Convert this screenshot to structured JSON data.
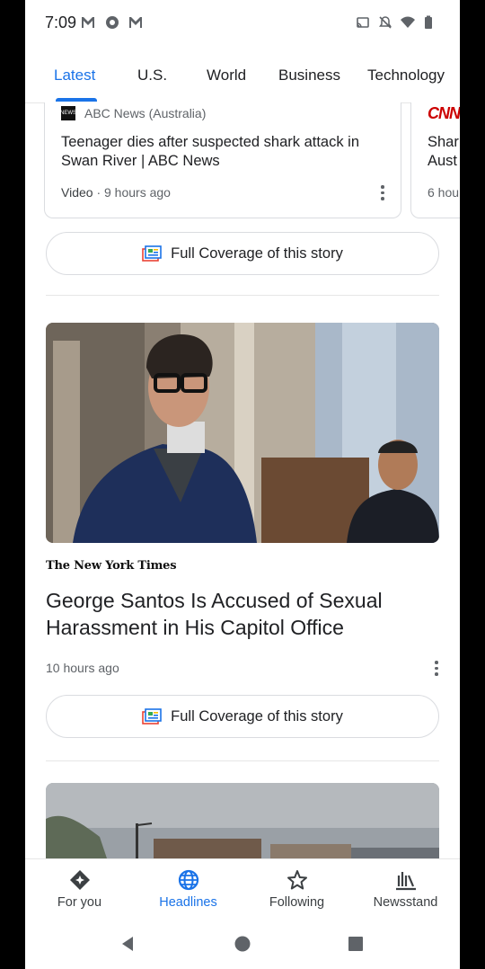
{
  "status_bar": {
    "time": "7:09",
    "icons": [
      "gmail-icon",
      "settings-app-icon",
      "gmail-icon",
      "cast-icon",
      "bell-off-icon",
      "wifi-icon",
      "battery-icon"
    ]
  },
  "tabs": [
    {
      "label": "Latest",
      "active": true
    },
    {
      "label": "U.S.",
      "active": false
    },
    {
      "label": "World",
      "active": false
    },
    {
      "label": "Business",
      "active": false
    },
    {
      "label": "Technology",
      "active": false
    }
  ],
  "carousel": {
    "card1": {
      "source": "ABC News (Australia)",
      "logo_text": "NEWS",
      "title": "Teenager dies after suspected shark attack in Swan River | ABC News",
      "meta_type": "Video",
      "meta_time": "· 9 hours ago"
    },
    "card2": {
      "source_logo": "CNN",
      "title_line1": "Shar",
      "title_line2": "Aust",
      "meta": "6 hou"
    }
  },
  "full_coverage_1": {
    "label": "Full Coverage of this story"
  },
  "story": {
    "publisher": "The New York Times",
    "headline": "George Santos Is Accused of Sexual Harassment in His Capitol Office",
    "time": "10 hours ago"
  },
  "full_coverage_2": {
    "label": "Full Coverage of this story"
  },
  "bottom_nav": [
    {
      "label": "For you",
      "icon": "for-you-icon",
      "active": false
    },
    {
      "label": "Headlines",
      "icon": "globe-icon",
      "active": true
    },
    {
      "label": "Following",
      "icon": "star-icon",
      "active": false
    },
    {
      "label": "Newsstand",
      "icon": "newsstand-icon",
      "active": false
    }
  ],
  "colors": {
    "accent": "#1a73e8",
    "text": "#202124",
    "secondary": "#5f6368",
    "cnn_red": "#cc0000"
  }
}
